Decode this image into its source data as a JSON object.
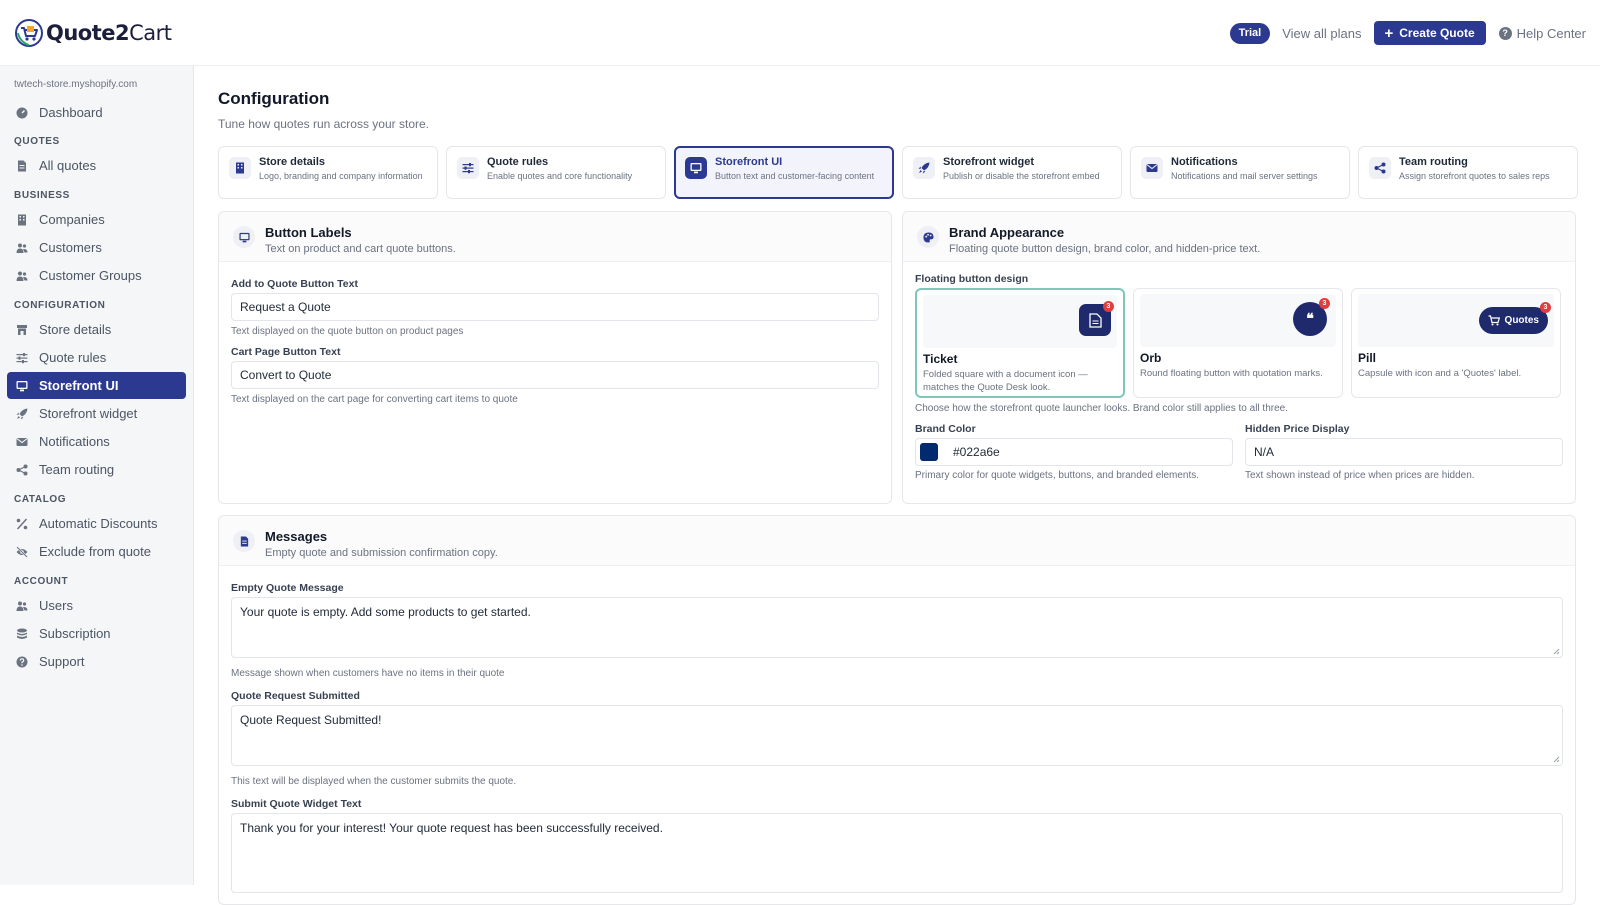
{
  "app": {
    "name": "Quote2Cart",
    "name_left": "Quote2",
    "name_right": "Cart"
  },
  "header": {
    "trial_badge": "Trial",
    "view_plans": "View all plans",
    "create_quote": "Create Quote",
    "help_center": "Help Center"
  },
  "sidebar": {
    "store_url": "twtech-store.myshopify.com",
    "dashboard": "Dashboard",
    "sections": {
      "quotes": "QUOTES",
      "business": "BUSINESS",
      "configuration": "CONFIGURATION",
      "catalog": "CATALOG",
      "account": "ACCOUNT"
    },
    "items": {
      "all_quotes": "All quotes",
      "companies": "Companies",
      "customers": "Customers",
      "customer_groups": "Customer Groups",
      "store_details": "Store details",
      "quote_rules": "Quote rules",
      "storefront_ui": "Storefront UI",
      "storefront_widget": "Storefront widget",
      "notifications": "Notifications",
      "team_routing": "Team routing",
      "automatic_discounts": "Automatic Discounts",
      "exclude_from_quote": "Exclude from quote",
      "users": "Users",
      "subscription": "Subscription",
      "support": "Support"
    },
    "active_item": "storefront_ui"
  },
  "page": {
    "title": "Configuration",
    "subtitle": "Tune how quotes run across your store."
  },
  "tabs": [
    {
      "title": "Store details",
      "desc": "Logo, branding and company information",
      "icon": "building-icon"
    },
    {
      "title": "Quote rules",
      "desc": "Enable quotes and core functionality",
      "icon": "sliders-icon"
    },
    {
      "title": "Storefront UI",
      "desc": "Button text and customer-facing content",
      "icon": "monitor-icon"
    },
    {
      "title": "Storefront widget",
      "desc": "Publish or disable the storefront embed",
      "icon": "rocket-icon"
    },
    {
      "title": "Notifications",
      "desc": "Notifications and mail server settings",
      "icon": "envelope-icon"
    },
    {
      "title": "Team routing",
      "desc": "Assign storefront quotes to sales reps",
      "icon": "share-icon"
    }
  ],
  "active_tab": 2,
  "button_labels": {
    "title": "Button Labels",
    "desc": "Text on product and cart quote buttons.",
    "add_to_quote_label": "Add to Quote Button Text",
    "add_to_quote_value": "Request a Quote",
    "add_to_quote_help": "Text displayed on the quote button on product pages",
    "cart_label": "Cart Page Button Text",
    "cart_value": "Convert to Quote",
    "cart_help": "Text displayed on the cart page for converting cart items to quote"
  },
  "brand": {
    "title": "Brand Appearance",
    "desc": "Floating quote button design, brand color, and hidden-price text.",
    "design_label": "Floating button design",
    "designs": [
      {
        "name": "Ticket",
        "desc": "Folded square with a document icon — matches the Quote Desk look.",
        "badge": "3"
      },
      {
        "name": "Orb",
        "desc": "Round floating button with quotation marks.",
        "badge": "3"
      },
      {
        "name": "Pill",
        "desc": "Capsule with icon and a 'Quotes' label.",
        "badge": "3",
        "pill_label": "Quotes"
      }
    ],
    "selected_design": "Ticket",
    "design_help": "Choose how the storefront quote launcher looks. Brand color still applies to all three.",
    "color_label": "Brand Color",
    "color_value": "#022a6e",
    "color_help": "Primary color for quote widgets, buttons, and branded elements.",
    "hidden_price_label": "Hidden Price Display",
    "hidden_price_value": "N/A",
    "hidden_price_help": "Text shown instead of price when prices are hidden."
  },
  "messages": {
    "title": "Messages",
    "desc": "Empty quote and submission confirmation copy.",
    "empty_label": "Empty Quote Message",
    "empty_value": "Your quote is empty. Add some products to get started.",
    "empty_help": "Message shown when customers have no items in their quote",
    "submitted_label": "Quote Request Submitted",
    "submitted_value": "Quote Request Submitted!",
    "submitted_help": "This text will be displayed when the customer submits the quote.",
    "widget_label": "Submit Quote Widget Text",
    "widget_value": "Thank you for your interest! Your quote request has been successfully received."
  },
  "colors": {
    "primary": "#2b3990",
    "brand_color": "#022a6e",
    "badge_red": "#e23d3d",
    "selected_border": "#7fc7bb"
  }
}
